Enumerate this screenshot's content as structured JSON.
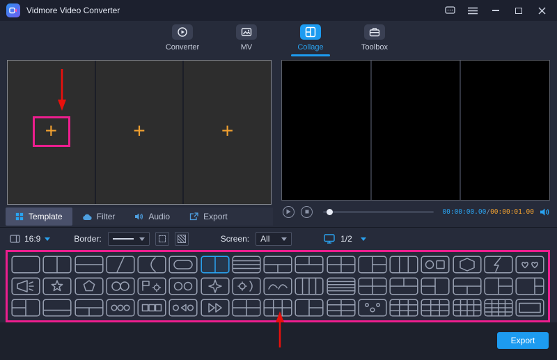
{
  "window": {
    "title": "Vidmore Video Converter"
  },
  "nav": {
    "tabs": [
      {
        "label": "Converter"
      },
      {
        "label": "MV"
      },
      {
        "label": "Collage"
      },
      {
        "label": "Toolbox"
      }
    ],
    "active": "Collage"
  },
  "editor": {
    "plus": "+"
  },
  "preview": {
    "time_current": "00:00:00.00",
    "time_divider": "/",
    "time_total": "00:00:01.00"
  },
  "panel_tabs": [
    {
      "label": "Template"
    },
    {
      "label": "Filter"
    },
    {
      "label": "Audio"
    },
    {
      "label": "Export"
    }
  ],
  "toolbar": {
    "ratio": "16:9",
    "border_label": "Border:",
    "screen_label": "Screen:",
    "screen_value": "All",
    "screen_page": "1/2"
  },
  "template_grid": {
    "selected": [
      0,
      6
    ],
    "rows": [
      [
        "blank",
        "v2",
        "h2",
        "diag",
        "curve",
        "rounded",
        "v2",
        "rows3",
        "h2bv",
        "h2tv",
        "grid22",
        "vrh",
        "v3",
        "circsq",
        "hex",
        "bolt",
        "hearts"
      ],
      [
        "horn",
        "star",
        "pentagon",
        "circles2",
        "flaggear",
        "oo",
        "spark",
        "geararc",
        "swoosh",
        "v4",
        "rows4",
        "grid22",
        "h2tv",
        "vlh",
        "h2bv",
        "vrh",
        "bigl"
      ],
      [
        "vlh",
        "h2b",
        "h2bv",
        "ooo",
        "sq3",
        "otrio",
        "ff",
        "grid22",
        "grid23",
        "vrh",
        "grid32",
        "dots",
        "grid33",
        "grid33",
        "grid43",
        "grid44",
        "wide"
      ]
    ]
  },
  "footer": {
    "export_label": "Export"
  },
  "colors": {
    "accent": "#1d9bf0",
    "highlight_box": "#ec1e8e",
    "plus_orange": "#f0a030",
    "annotation_arrow": "#e8100c",
    "time_current": "#2aa3f0",
    "time_total": "#f0a030"
  }
}
